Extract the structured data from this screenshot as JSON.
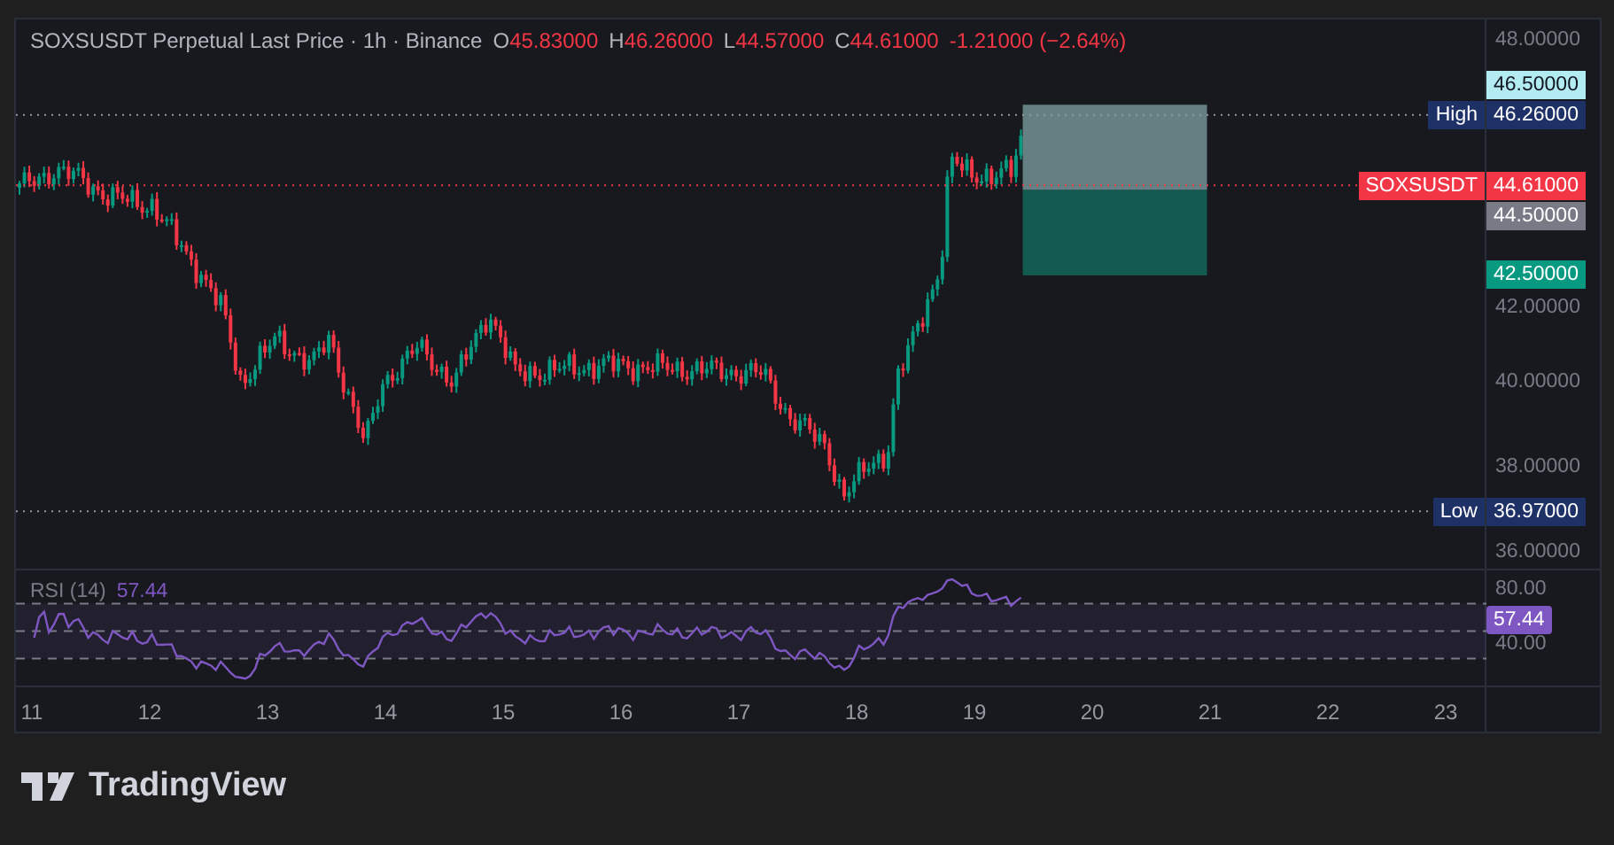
{
  "legend": {
    "title": "SOXSUSDT Perpetual Last Price · 1h · Binance",
    "ohlc": [
      {
        "label": "O",
        "value": "45.83000"
      },
      {
        "label": "H",
        "value": "46.26000"
      },
      {
        "label": "L",
        "value": "44.57000"
      },
      {
        "label": "C",
        "value": "44.61000"
      }
    ],
    "change": "-1.21000 (−2.64%)"
  },
  "price_axis": {
    "ticks": [
      "48.00000",
      "42.00000",
      "40.00000",
      "38.00000",
      "36.00000"
    ],
    "labels": [
      {
        "kind": "stop",
        "text": "46.50000",
        "color": "#b2ebf2"
      },
      {
        "kind": "high",
        "title": "High",
        "text": "46.26000",
        "color": "#1e3166"
      },
      {
        "kind": "last",
        "title": "SOXSUSDT",
        "text": "44.61000",
        "color": "#f23645"
      },
      {
        "kind": "entry",
        "text": "44.50000",
        "color": "#787b86"
      },
      {
        "kind": "target",
        "text": "42.50000",
        "color": "#089981"
      },
      {
        "kind": "low",
        "title": "Low",
        "text": "36.97000",
        "color": "#1e3166"
      }
    ]
  },
  "rsi": {
    "title": "RSI (14)",
    "value": "57.44",
    "ticks": [
      "80.00",
      "40.00"
    ],
    "value_label": "57.44"
  },
  "time_axis": [
    "11",
    "12",
    "13",
    "14",
    "15",
    "16",
    "17",
    "18",
    "19",
    "20",
    "21",
    "22",
    "23"
  ],
  "footer": {
    "brand": "TradingView"
  }
}
